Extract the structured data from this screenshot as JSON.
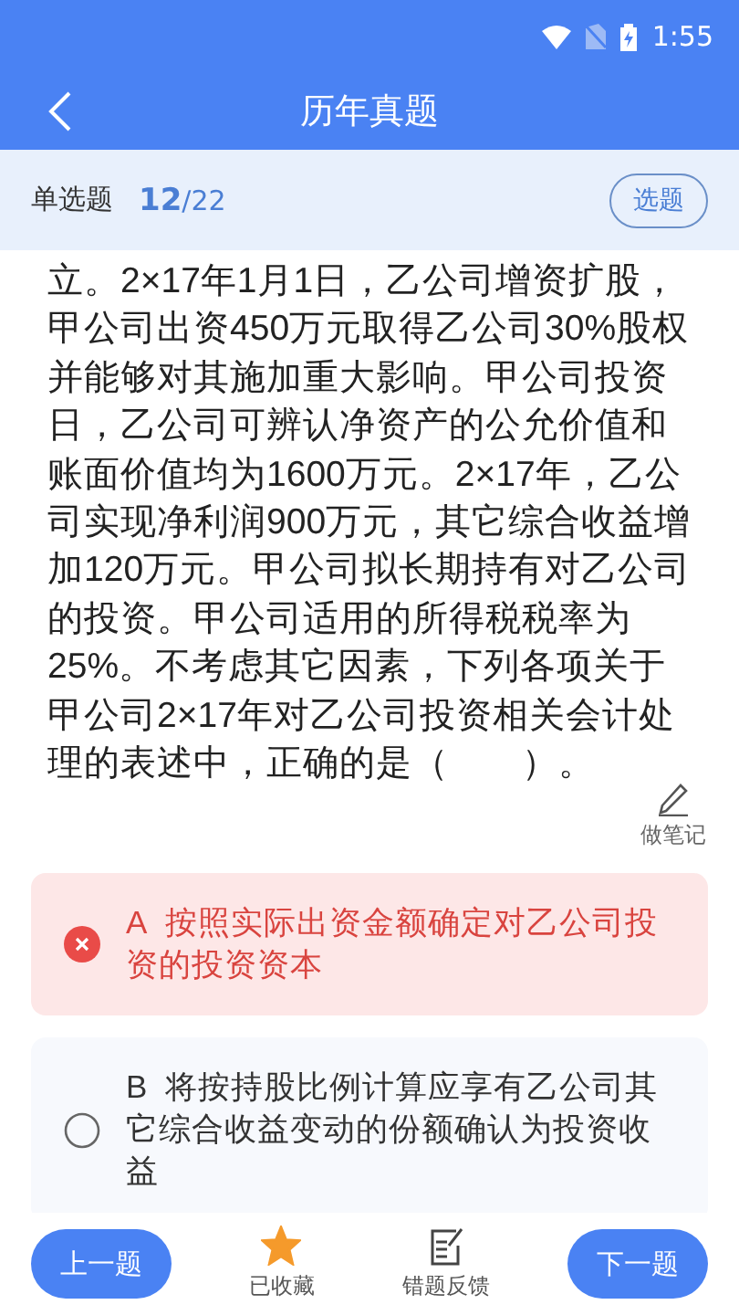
{
  "status_bar": {
    "time": "1:55"
  },
  "header": {
    "title": "历年真题"
  },
  "question_bar": {
    "type": "单选题",
    "current": "12",
    "total": "/22",
    "pick_button": "选题"
  },
  "question": {
    "text": "立。2×17年1月1日，乙公司增资扩股，甲公司出资450万元取得乙公司30%股权并能够对其施加重大影响。甲公司投资日，乙公司可辨认净资产的公允价值和账面价值均为1600万元。2×17年，乙公司实现净利润900万元，其它综合收益增加120万元。甲公司拟长期持有对乙公司的投资。甲公司适用的所得税税率为25%。不考虑其它因素，下列各项关于甲公司2×17年对乙公司投资相关会计处理的表述中，正确的是（　　）。",
    "note_label": "做笔记"
  },
  "options": [
    {
      "letter": "A",
      "text": "按照实际出资金额确定对乙公司投资的投资资本",
      "kind": "wrong"
    },
    {
      "letter": "B",
      "text": "将按持股比例计算应享有乙公司其它综合收益变动的份额确认为投资收益",
      "kind": "plain"
    }
  ],
  "bottom_bar": {
    "prev": "上一题",
    "favorite": {
      "label": "已收藏",
      "on": true
    },
    "feedback": "错题反馈",
    "next": "下一题"
  }
}
